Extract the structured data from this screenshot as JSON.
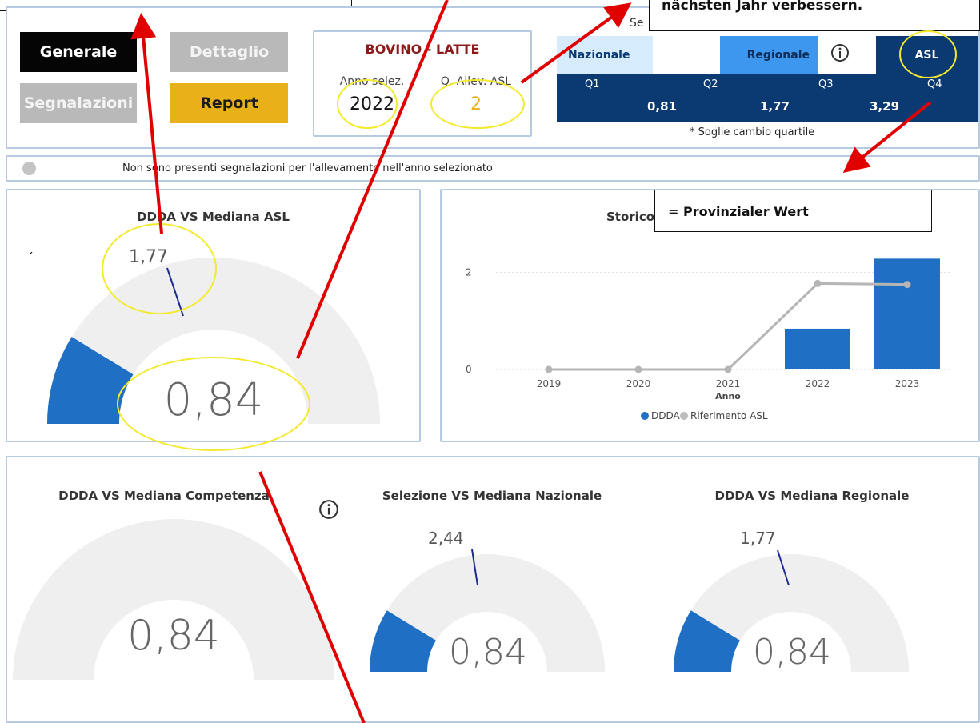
{
  "nav": {
    "generale": "Generale",
    "dettaglio": "Dettaglio",
    "segnalazioni": "Segnalazioni",
    "report": "Report"
  },
  "selection": {
    "title": "BOVINO - LATTE",
    "year_label": "Anno selez.",
    "year_value": "2022",
    "qallev_label": "Q. Allev. ASL",
    "qallev_value": "2"
  },
  "scope": {
    "header_partial": "Se",
    "nazionale": "Nazionale",
    "regionale": "Regionale",
    "asl": "ASL",
    "q_labels": [
      "Q1",
      "Q2",
      "Q3",
      "Q4"
    ],
    "thresholds": [
      "0,81",
      "1,77",
      "3,29"
    ],
    "footnote": "* Soglie cambio quartile"
  },
  "status": {
    "message": "Non sono presenti segnalazioni per l'allevamento nell'anno selezionato"
  },
  "gauges": {
    "asl": {
      "title": "DDDA VS Mediana ASL",
      "value": "0,84",
      "target": "1,77",
      "mark": "´"
    },
    "competenza": {
      "title": "DDDA VS Mediana Competenza",
      "value": "0,84"
    },
    "nazionale": {
      "title": "Selezione VS Mediana Nazionale",
      "value": "0,84",
      "target": "2,44"
    },
    "regionale": {
      "title": "DDDA VS Mediana Regionale",
      "value": "0,84",
      "target": "1,77"
    }
  },
  "history": {
    "title_partial": "Storico"
  },
  "annotations": {
    "top_note": "nächsten Jahr verbessern.",
    "provincial": "= Provinzialer Wert"
  },
  "colors": {
    "accent_blue": "#1f6fc5",
    "dark_navy": "#0b3a73",
    "gauge_bg": "#efefef",
    "report_yellow": "#e8b11a",
    "arrow_red": "#e00000",
    "highlight_yellow": "#f3ea2f",
    "maroon": "#8b1a1a"
  },
  "chart_data": {
    "type": "bar",
    "categories": [
      "2019",
      "2020",
      "2021",
      "2022",
      "2023"
    ],
    "series": [
      {
        "name": "DDDA",
        "type": "bar",
        "values": [
          0,
          0,
          0,
          0.84,
          2.28
        ]
      },
      {
        "name": "Riferimento ASL",
        "type": "line",
        "values": [
          0,
          0,
          0,
          1.77,
          1.75
        ]
      }
    ],
    "xlabel": "Anno",
    "ylabel": "",
    "ylim": [
      0,
      2.5
    ],
    "yticks": [
      "0",
      "2"
    ],
    "legend": "bottom"
  }
}
